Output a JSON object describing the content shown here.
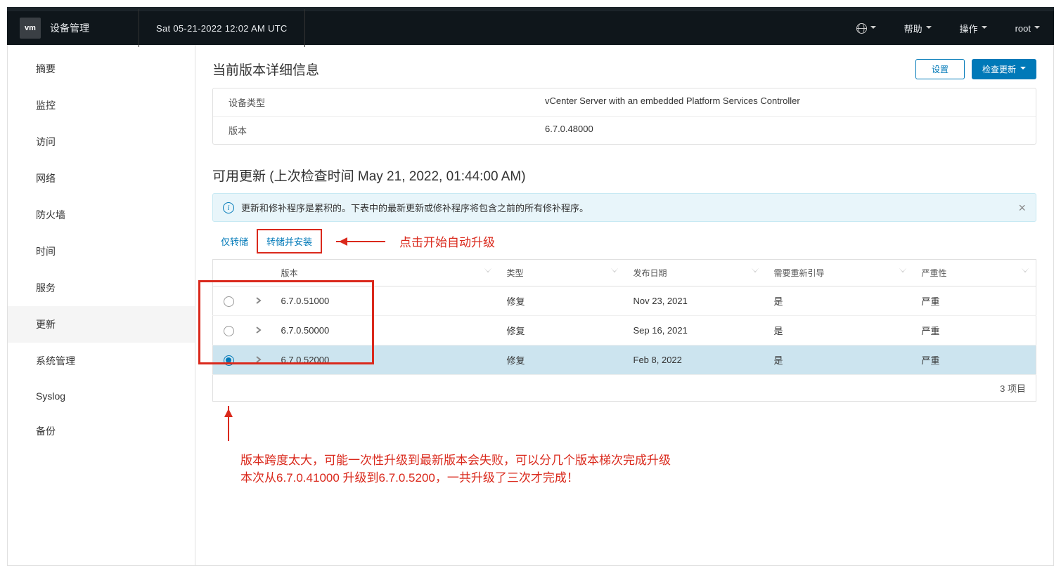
{
  "header": {
    "logo": "vm",
    "app_title": "设备管理",
    "datetime": "Sat 05-21-2022 12:02 AM UTC",
    "help": "帮助",
    "actions": "操作",
    "user": "root"
  },
  "sidebar": {
    "items": [
      "摘要",
      "监控",
      "访问",
      "网络",
      "防火墙",
      "时间",
      "服务",
      "更新",
      "系统管理",
      "Syslog",
      "备份"
    ],
    "active_index": 7
  },
  "details": {
    "title": "当前版本详细信息",
    "settings_btn": "设置",
    "check_btn": "检查更新",
    "rows": [
      {
        "label": "设备类型",
        "value": "vCenter Server with an embedded Platform Services Controller"
      },
      {
        "label": "版本",
        "value": "6.7.0.48000"
      }
    ]
  },
  "updates": {
    "title": "可用更新 (上次检查时间 May 21, 2022, 01:44:00 AM)",
    "alert": "更新和修补程序是累积的。下表中的最新更新或修补程序将包含之前的所有修补程序。",
    "stage_only": "仅转储",
    "stage_install": "转储并安装",
    "columns": {
      "version": "版本",
      "type": "类型",
      "date": "发布日期",
      "reboot": "需要重新引导",
      "severity": "严重性"
    },
    "rows": [
      {
        "version": "6.7.0.51000",
        "type": "修复",
        "date": "Nov 23, 2021",
        "reboot": "是",
        "severity": "严重",
        "selected": false
      },
      {
        "version": "6.7.0.50000",
        "type": "修复",
        "date": "Sep 16, 2021",
        "reboot": "是",
        "severity": "严重",
        "selected": false
      },
      {
        "version": "6.7.0.52000",
        "type": "修复",
        "date": "Feb 8, 2022",
        "reboot": "是",
        "severity": "严重",
        "selected": true
      }
    ],
    "footer": "3 项目"
  },
  "annotations": {
    "click_hint": "点击开始自动升级",
    "note_l1": "版本跨度太大，可能一次性升级到最新版本会失败，可以分几个版本梯次完成升级",
    "note_l2": "本次从6.7.0.41000 升级到6.7.0.5200，一共升级了三次才完成！"
  }
}
